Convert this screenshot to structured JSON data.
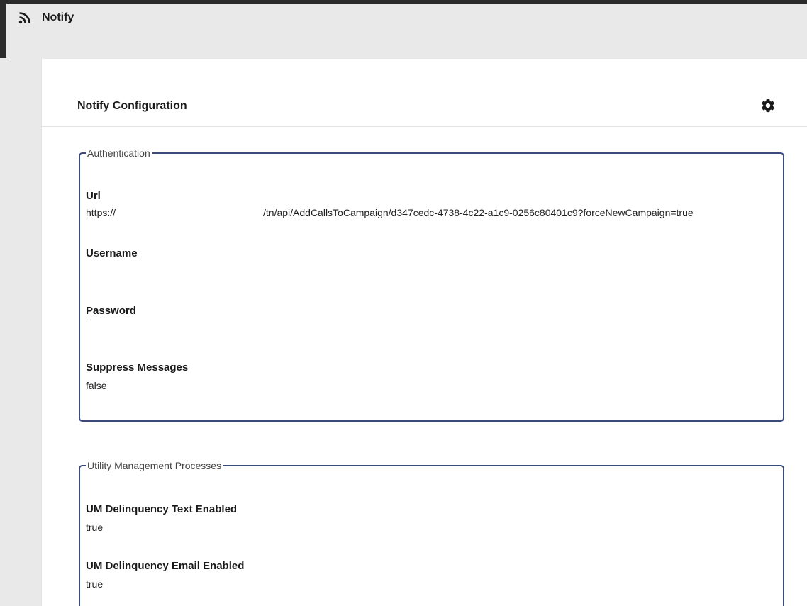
{
  "app": {
    "title": "Notify",
    "icon": "rss-feed-icon"
  },
  "card": {
    "title": "Notify Configuration",
    "settings_icon": "gear-icon"
  },
  "authentication": {
    "legend": "Authentication",
    "url_label": "Url",
    "url_value_prefix": "https://",
    "url_value_path": "/tn/api/AddCallsToCampaign/d347cedc-4738-4c22-a1c9-0256c80401c9?forceNewCampaign=true",
    "username_label": "Username",
    "username_value": "",
    "password_label": "Password",
    "password_value": ".",
    "suppress_label": "Suppress Messages",
    "suppress_value": "false"
  },
  "utility_management": {
    "legend": "Utility Management Processes",
    "text_enabled_label": "UM Delinquency Text Enabled",
    "text_enabled_value": "true",
    "email_enabled_label": "UM Delinquency Email Enabled",
    "email_enabled_value": "true"
  },
  "colors": {
    "fieldset_border": "#3b4a78",
    "page_background": "#e9e9e9",
    "card_background": "#ffffff"
  }
}
